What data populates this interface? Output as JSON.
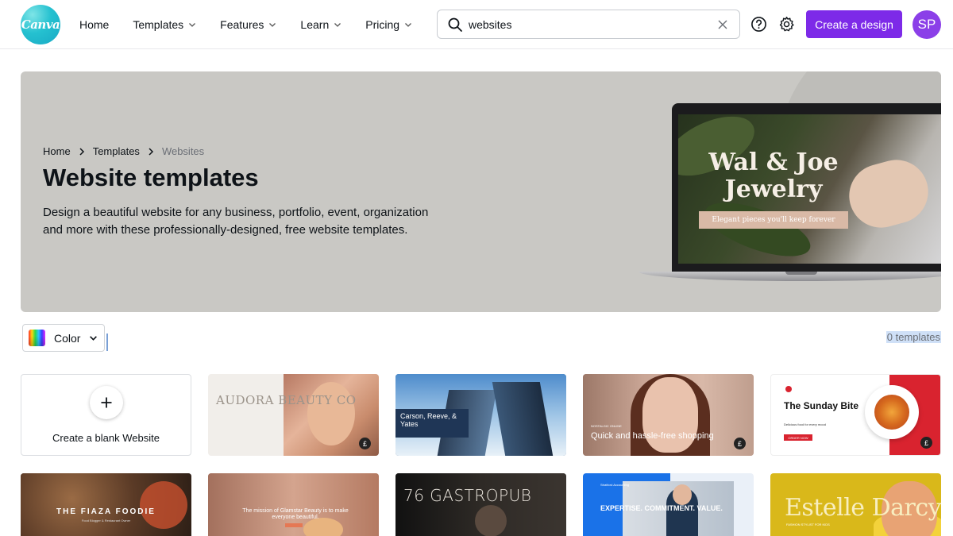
{
  "header": {
    "logo_text": "Canva",
    "nav": [
      {
        "label": "Home",
        "has_dropdown": false
      },
      {
        "label": "Templates",
        "has_dropdown": true
      },
      {
        "label": "Features",
        "has_dropdown": true
      },
      {
        "label": "Learn",
        "has_dropdown": true
      },
      {
        "label": "Pricing",
        "has_dropdown": true
      }
    ],
    "search": {
      "value": "websites",
      "icon": "search-icon",
      "clear_icon": "close-icon"
    },
    "help_icon": "help-circle-icon",
    "settings_icon": "gear-icon",
    "create_button": "Create a design",
    "avatar_initials": "SP",
    "accent_color": "#7d2ae8"
  },
  "hero": {
    "breadcrumb": [
      "Home",
      "Templates",
      "Websites"
    ],
    "title": "Website templates",
    "description": "Design a beautiful website for any business, portfolio, event, organization and more with these professionally-designed, free website templates.",
    "preview_title": "Wal & Joe Jewelry",
    "preview_subtitle": "Elegant pieces you'll keep forever"
  },
  "filters": {
    "color_label": "Color",
    "template_count": "0 templates"
  },
  "grid": {
    "blank_card_label": "Create a blank Website",
    "templates": [
      {
        "preview_text": "AUDORA BEAUTY CO",
        "pro": true
      },
      {
        "preview_text": "Carson, Reeve, & Yates",
        "pro": false
      },
      {
        "preview_tag": "NOSTALGIC ONLINE",
        "preview_text": "Quick and hassle-free shopping",
        "pro": true
      },
      {
        "preview_text": "The Sunday Bite",
        "preview_sub": "Delicious food for every mood",
        "preview_button": "ORDER NOW",
        "pro": true
      },
      {
        "preview_text": "THE FIAZA FOODIE",
        "preview_sub": "Food Blogger & Restaurant Owner",
        "pro": false
      },
      {
        "preview_text": "The mission of Glamstar Beauty is to make everyone beautiful.",
        "pro": false
      },
      {
        "preview_text": "76 GASTROPUB",
        "pro": false
      },
      {
        "preview_brand": "Stratford Accounting",
        "preview_text": "EXPERTISE. COMMITMENT. VALUE.",
        "pro": false
      },
      {
        "preview_text": "Estelle Darcy",
        "preview_sub": "FASHION STYLIST FOR KIDS",
        "pro": false
      }
    ],
    "pro_badge_symbol": "£"
  }
}
